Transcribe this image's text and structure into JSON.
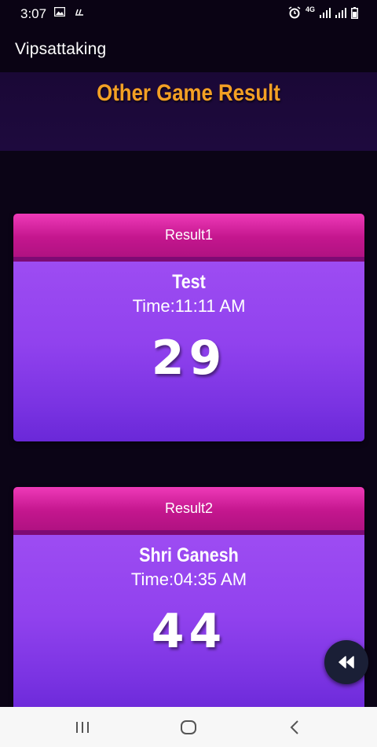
{
  "status_bar": {
    "time": "3:07",
    "network": "4G"
  },
  "app_bar": {
    "title": "Vipsattaking"
  },
  "banner": {
    "title": "Other Game Result"
  },
  "results": [
    {
      "header": "Result1",
      "game": "Test",
      "time": "Time:11:11 AM",
      "number": "29"
    },
    {
      "header": "Result2",
      "game": "Shri Ganesh",
      "time": "Time:04:35 AM",
      "number": "44"
    }
  ],
  "icons": {
    "fab": "rewind-icon",
    "nav_recents": "recents-icon",
    "nav_home": "home-icon",
    "nav_back": "back-icon"
  },
  "colors": {
    "banner_title": "#f3a024",
    "card_header": "#c4168e",
    "card_body": "#9142ee",
    "background": "#0b0416"
  }
}
